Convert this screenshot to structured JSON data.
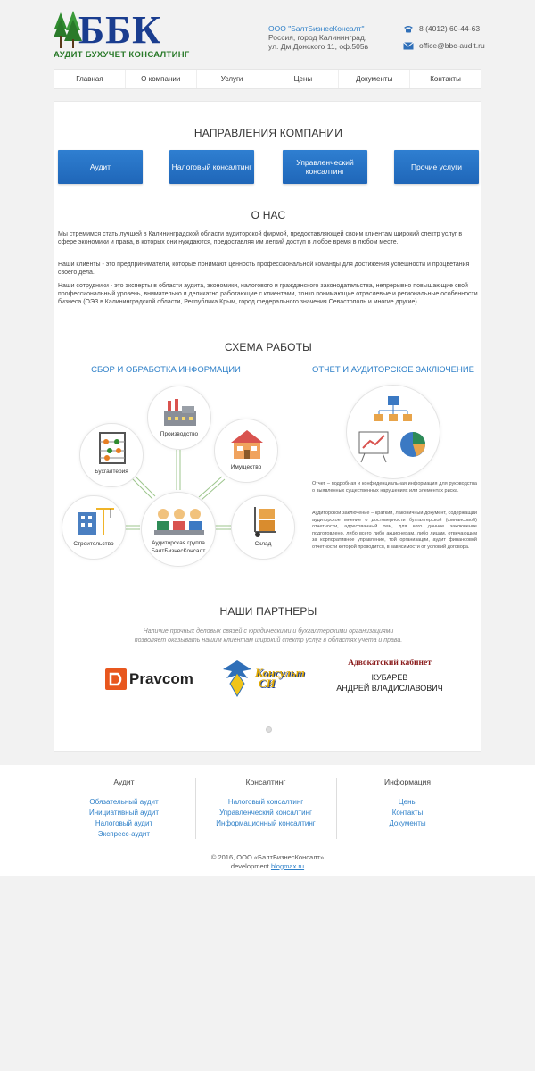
{
  "header": {
    "logo_letters": "ББК",
    "logo_tagline": "АУДИТ БУХУЧЕТ КОНСАЛТИНГ",
    "company_name": "ООО \"БалтБизнесКонсалт\"",
    "address_line1": "Россия, город Калининград,",
    "address_line2": "ул. Дм.Донского 11, оф.505в",
    "phone": "8 (4012) 60-44-63",
    "email": "office@bbc-audit.ru"
  },
  "nav": [
    "Главная",
    "О компании",
    "Услуги",
    "Цены",
    "Документы",
    "Контакты"
  ],
  "directions": {
    "title": "НАПРАВЛЕНИЯ КОМПАНИИ",
    "buttons": [
      "Аудит",
      "Налоговый консалтинг",
      "Управленческий консалтинг",
      "Прочие услуги"
    ]
  },
  "about": {
    "title": "О НАС",
    "p1": "Мы стремимся стать лучшей в Калининградской области аудиторской фирмой, предоставляющей своим клиентам широкий спектр услуг в сфере экономики и права, в которых они нуждаются, предоставляя им легкий доступ в любое время в любом месте.",
    "p2": "Наши клиенты - это предприниматели, которые понимают ценность профессиональной команды для достижения успешности и процветания своего дела.",
    "p3": "Наши сотрудники - это эксперты в области аудита, экономики, налогового и гражданского законодательства, непрерывно повышающие свой профессиональный уровень, внимательно и деликатно работающие с клиентами, тонко понимающие отраслевые и региональные особенности бизнеса (ОЭЗ в Калининградской области, Республика Крым, город федерального значения Севастополь и многие другие)."
  },
  "scheme": {
    "title": "СХЕМА РАБОТЫ",
    "left_title": "СБОР И ОБРАБОТКА ИНФОРМАЦИИ",
    "right_title": "ОТЧЕТ И АУДИТОРСКОЕ ЗАКЛЮЧЕНИЕ",
    "nodes": {
      "production": "Производство",
      "accounting": "Бухгалтерия",
      "property": "Имущество",
      "group_line1": "Аудиторская группа",
      "group_line2": "БалтБизнесКонсалт",
      "construction": "Строительство",
      "warehouse": "Склад"
    },
    "report_p1": "Отчет – подробная и конфиденциальная информация для руководства о выявленных существенных нарушениях или элементах риска.",
    "report_p2": "Аудиторской заключение – краткий, лаконичный документ, содержащий аудиторское мнение о достоверности бухгалтерской (финансовой) отчетности, адресованный тем, для кого данное заключение подготовлено, либо всего либо акционерам, либо лицам, отвечающим за корпоративное управление, той организации, аудит финансовой отчетности которой проводится, в зависимости от условий договора."
  },
  "partners": {
    "title": "НАШИ ПАРТНЕРЫ",
    "note_line1": "Наличие прочных деловых связей с юридическими и бухгалтерскими организациями",
    "note_line2": "позволяет оказывать нашим клиентам широкий спектр услуг в областях учета и права.",
    "pravcom": "Pravcom",
    "konsult_line1": "Консульт",
    "konsult_line2": "СИ",
    "lawyer_title": "Адвокатский кабинет",
    "lawyer_name1": "КУБАРЕВ",
    "lawyer_name2": "АНДРЕЙ ВЛАДИСЛАВОВИЧ"
  },
  "footer": {
    "col1_title": "Аудит",
    "col1_links": [
      "Обязательный аудит",
      "Инициативный аудит",
      "Налоговый аудит",
      "Экспресс-аудит"
    ],
    "col2_title": "Консалтинг",
    "col2_links": [
      "Налоговый консалтинг",
      "Управленческий консалтинг",
      "Информационный консалтинг"
    ],
    "col3_title": "Информация",
    "col3_links": [
      "Цены",
      "Контакты",
      "Документы"
    ],
    "copyright": "© 2016, ООО «БалтБизнесКонсалт»",
    "dev_prefix": "development",
    "dev_link": "blogmax.ru"
  },
  "colors": {
    "accent_blue": "#2f80c8",
    "button_blue": "#1f66b8",
    "logo_blue": "#1a3d8f",
    "logo_green": "#2a7a2a"
  }
}
